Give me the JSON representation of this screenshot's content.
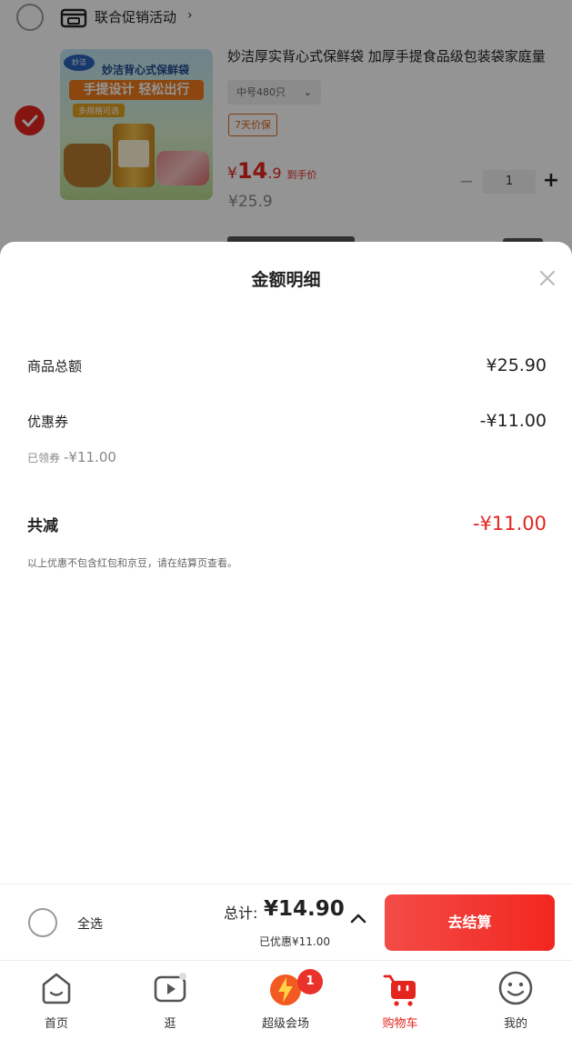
{
  "store": {
    "name": "联合促销活动",
    "chevron": "›"
  },
  "item": {
    "title": "妙洁厚实背心式保鲜袋 加厚手提食品级包装袋家庭量",
    "spec": "中号480只",
    "protect": "7天价保",
    "price_yen": "¥",
    "price_int": "14",
    "price_dec": ".9",
    "price_tag": "到手价",
    "original_price": "¥25.9",
    "quantity": "1",
    "minus": "−",
    "plus": "+",
    "image_text": {
      "logo": "妙洁",
      "title": "妙洁背心式保鲜袋",
      "banner": "手提设计 轻松出行",
      "sub": "多规格可选"
    }
  },
  "sheet": {
    "title": "金额明细",
    "rows": {
      "goods_total_label": "商品总额",
      "goods_total_value": "¥25.90",
      "coupon_label": "优惠券",
      "coupon_value": "-¥11.00",
      "claimed_label": "已领券",
      "claimed_value": "-¥11.00",
      "total_reduced_label": "共减",
      "total_reduced_value": "-¥11.00"
    },
    "note": "以上优惠不包含红包和京豆，请在结算页查看。"
  },
  "checkout": {
    "select_all": "全选",
    "sum_label": "总计:",
    "sum_value": "¥14.90",
    "saved": "已优惠¥11.00",
    "button": "去结算"
  },
  "tabs": [
    {
      "label": "首页",
      "icon": "home-icon"
    },
    {
      "label": "逛",
      "icon": "play-icon"
    },
    {
      "label": "超级会场",
      "icon": "super-venue-icon"
    },
    {
      "label": "购物车",
      "icon": "cart-icon"
    },
    {
      "label": "我的",
      "icon": "smiley-face-icon"
    }
  ],
  "badge": "1",
  "colors": {
    "accent": "#e3251e",
    "checkout_button": "#f2271f",
    "overlay": "rgba(0,0,0,0.42)"
  }
}
